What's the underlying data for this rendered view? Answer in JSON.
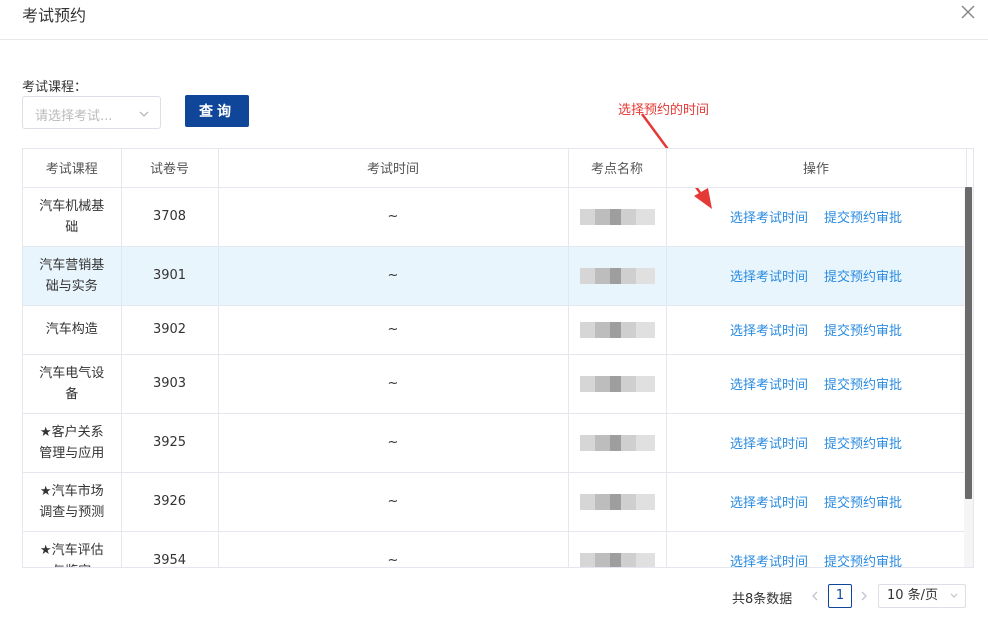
{
  "dialog": {
    "title": "考试预约"
  },
  "filter": {
    "label": "考试课程：",
    "placeholder": "请选择考试...",
    "query_label": "查询"
  },
  "annotation": {
    "text": "选择预约的时间"
  },
  "table": {
    "headers": [
      "考试课程",
      "试卷号",
      "考试时间",
      "考点名称",
      "操作"
    ],
    "rows": [
      {
        "course": "汽车机械基础",
        "paper": "3708",
        "time": "~",
        "highlight": false
      },
      {
        "course": "汽车营销基础与实务",
        "paper": "3901",
        "time": "~",
        "highlight": true
      },
      {
        "course": "汽车构造",
        "paper": "3902",
        "time": "~",
        "highlight": false
      },
      {
        "course": "汽车电气设备",
        "paper": "3903",
        "time": "~",
        "highlight": false
      },
      {
        "course": "★客户关系管理与应用",
        "paper": "3925",
        "time": "~",
        "highlight": false
      },
      {
        "course": "★汽车市场调查与预测",
        "paper": "3926",
        "time": "~",
        "highlight": false
      },
      {
        "course": "★汽车评估与鉴定",
        "paper": "3954",
        "time": "~",
        "highlight": false
      }
    ],
    "action_select": "选择考试时间",
    "action_submit": "提交预约审批"
  },
  "pagination": {
    "total_text": "共8条数据",
    "current_page": "1",
    "page_size": "10 条/页"
  },
  "colors": {
    "primary": "#0f4699",
    "link": "#2a8be0",
    "annotation": "#e53935",
    "highlight_row": "#e9f5fd"
  }
}
